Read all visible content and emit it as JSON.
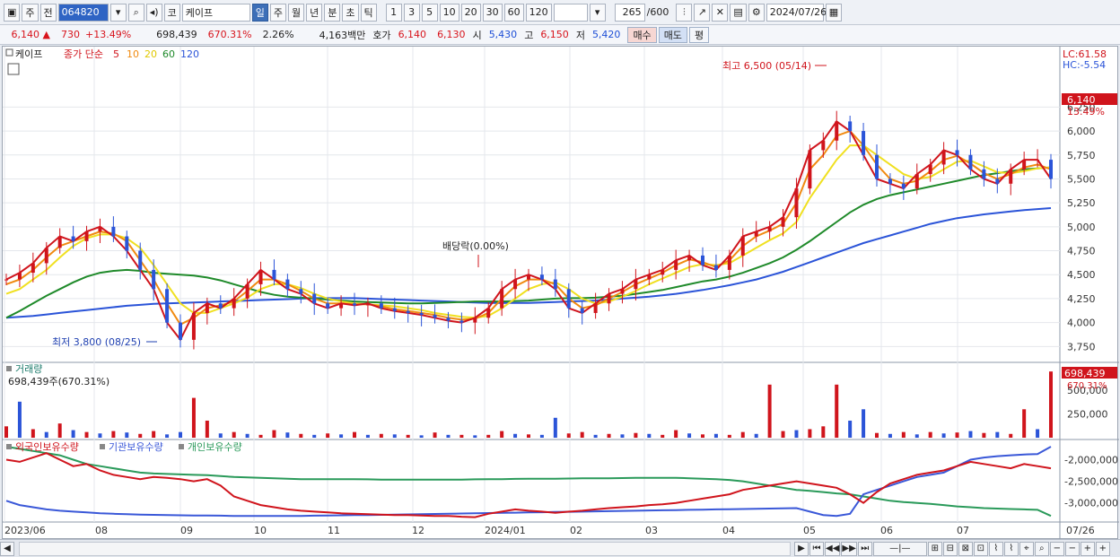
{
  "toolbar": {
    "market": "주",
    "prev": "전",
    "code": "064820",
    "type": "코",
    "name": "케이프",
    "periods": [
      "일",
      "주",
      "월",
      "년",
      "분",
      "초",
      "틱"
    ],
    "active_period": "일",
    "intervals": [
      "1",
      "3",
      "5",
      "10",
      "20",
      "30",
      "60",
      "120"
    ],
    "count": "265",
    "count_total": "/600",
    "date": "2024/07/26"
  },
  "quote": {
    "price": "6,140",
    "change": "730",
    "change_pct": "+13.49%",
    "volume": "698,439",
    "vol_ratio": "670.31%",
    "turnover": "2.26%",
    "amount": "4,163백만",
    "ask_label": "호가",
    "ask": "6,140",
    "bid": "6,130",
    "open_label": "시",
    "open": "5,430",
    "high_label": "고",
    "high": "6,150",
    "low_label": "저",
    "low": "5,420",
    "buy": "매수",
    "sell": "매도",
    "eval": "평"
  },
  "chart_data": {
    "type": "line",
    "legend": {
      "stock": "케이프",
      "ma_label": "종가 단순",
      "ma_periods": [
        "5",
        "10",
        "20",
        "60",
        "120"
      ],
      "ma_colors": [
        "#d0141c",
        "#f08a10",
        "#f0e020",
        "#1f8a2a",
        "#2b54d8"
      ]
    },
    "x_ticks": [
      "2023/06",
      "08",
      "09",
      "10",
      "11",
      "12",
      "2024/01",
      "02",
      "03",
      "04",
      "05",
      "06",
      "07",
      "07/26"
    ],
    "price_axis": {
      "ticks": [
        "6,250",
        "6,000",
        "5,750",
        "5,500",
        "5,250",
        "5,000",
        "4,750",
        "4,500",
        "4,250",
        "4,000",
        "3,750"
      ],
      "lc": "LC:61.58",
      "hc": "HC:-5.54",
      "current": "6,140",
      "current_pct": "13.49%",
      "ylim": [
        3650,
        6600
      ]
    },
    "annotations": {
      "high": "최고 6,500 (05/14)",
      "low": "최저 3,800 (08/25)",
      "dividend": "배당락(0.00%)"
    },
    "ma5": [
      4450,
      4520,
      4620,
      4780,
      4900,
      4850,
      4950,
      5000,
      4900,
      4750,
      4550,
      4350,
      4000,
      3820,
      4100,
      4200,
      4150,
      4250,
      4400,
      4550,
      4450,
      4350,
      4300,
      4200,
      4150,
      4200,
      4180,
      4200,
      4150,
      4120,
      4100,
      4080,
      4050,
      4020,
      4000,
      4050,
      4150,
      4350,
      4450,
      4500,
      4450,
      4350,
      4150,
      4100,
      4200,
      4300,
      4350,
      4450,
      4500,
      4550,
      4650,
      4700,
      4600,
      4550,
      4700,
      4900,
      4950,
      5000,
      5100,
      5400,
      5800,
      5900,
      6100,
      6000,
      5750,
      5500,
      5450,
      5400,
      5550,
      5650,
      5800,
      5750,
      5600,
      5500,
      5450,
      5600,
      5700,
      5700,
      5500
    ],
    "ma10": [
      4400,
      4450,
      4550,
      4680,
      4800,
      4850,
      4900,
      4950,
      4930,
      4850,
      4650,
      4450,
      4200,
      3980,
      4050,
      4150,
      4180,
      4220,
      4330,
      4450,
      4450,
      4400,
      4330,
      4250,
      4200,
      4200,
      4190,
      4190,
      4170,
      4140,
      4120,
      4100,
      4080,
      4050,
      4030,
      4040,
      4100,
      4250,
      4380,
      4450,
      4450,
      4400,
      4250,
      4150,
      4180,
      4250,
      4320,
      4400,
      4460,
      4520,
      4600,
      4660,
      4630,
      4580,
      4650,
      4800,
      4900,
      4960,
      5030,
      5250,
      5600,
      5750,
      5950,
      6000,
      5850,
      5650,
      5500,
      5450,
      5480,
      5580,
      5700,
      5740,
      5660,
      5560,
      5500,
      5550,
      5620,
      5650,
      5600
    ],
    "ma20": [
      4300,
      4350,
      4450,
      4550,
      4680,
      4800,
      4880,
      4920,
      4920,
      4880,
      4780,
      4600,
      4400,
      4200,
      4100,
      4100,
      4150,
      4200,
      4260,
      4350,
      4400,
      4400,
      4360,
      4300,
      4250,
      4220,
      4200,
      4190,
      4180,
      4170,
      4150,
      4130,
      4100,
      4080,
      4060,
      4050,
      4070,
      4150,
      4250,
      4350,
      4400,
      4420,
      4350,
      4250,
      4200,
      4220,
      4270,
      4330,
      4400,
      4460,
      4520,
      4580,
      4610,
      4600,
      4620,
      4700,
      4780,
      4860,
      4930,
      5050,
      5300,
      5500,
      5700,
      5850,
      5850,
      5750,
      5650,
      5550,
      5500,
      5520,
      5600,
      5680,
      5690,
      5630,
      5570,
      5560,
      5580,
      5610,
      5620
    ],
    "ma60": [
      4050,
      4120,
      4200,
      4280,
      4350,
      4420,
      4480,
      4520,
      4540,
      4550,
      4540,
      4520,
      4510,
      4500,
      4490,
      4470,
      4440,
      4400,
      4360,
      4320,
      4290,
      4270,
      4260,
      4250,
      4240,
      4230,
      4220,
      4215,
      4210,
      4205,
      4200,
      4200,
      4205,
      4210,
      4215,
      4220,
      4220,
      4220,
      4225,
      4230,
      4240,
      4250,
      4255,
      4255,
      4260,
      4270,
      4280,
      4300,
      4320,
      4340,
      4370,
      4400,
      4430,
      4450,
      4480,
      4520,
      4570,
      4620,
      4680,
      4760,
      4850,
      4950,
      5050,
      5150,
      5230,
      5290,
      5330,
      5360,
      5390,
      5420,
      5450,
      5480,
      5510,
      5540,
      5560,
      5580,
      5600,
      5610,
      5620
    ],
    "ma120": [
      4050,
      4060,
      4070,
      4085,
      4100,
      4115,
      4130,
      4145,
      4160,
      4175,
      4185,
      4195,
      4200,
      4205,
      4210,
      4215,
      4220,
      4225,
      4230,
      4235,
      4240,
      4245,
      4250,
      4255,
      4255,
      4255,
      4255,
      4250,
      4245,
      4240,
      4235,
      4230,
      4225,
      4220,
      4215,
      4210,
      4205,
      4205,
      4205,
      4205,
      4210,
      4215,
      4220,
      4225,
      4230,
      4240,
      4250,
      4260,
      4270,
      4285,
      4300,
      4320,
      4340,
      4365,
      4390,
      4420,
      4450,
      4490,
      4530,
      4580,
      4630,
      4680,
      4730,
      4780,
      4830,
      4870,
      4910,
      4950,
      4990,
      5030,
      5060,
      5090,
      5110,
      5130,
      5145,
      5160,
      5175,
      5185,
      5195
    ],
    "volume": {
      "label": "거래량",
      "value_text": "698,439주(670.31%)",
      "current": "698,439",
      "current_pct": "670.31%",
      "ticks": [
        "500,000",
        "250,000"
      ],
      "ylim": [
        0,
        700000
      ],
      "values": [
        120000,
        380000,
        90000,
        60000,
        150000,
        80000,
        60000,
        45000,
        70000,
        55000,
        40000,
        70000,
        35000,
        60000,
        420000,
        180000,
        45000,
        60000,
        40000,
        30000,
        80000,
        55000,
        40000,
        30000,
        45000,
        35000,
        60000,
        30000,
        40000,
        35000,
        30000,
        25000,
        55000,
        30000,
        30000,
        25000,
        30000,
        70000,
        40000,
        35000,
        30000,
        210000,
        45000,
        60000,
        30000,
        40000,
        35000,
        50000,
        40000,
        30000,
        80000,
        45000,
        35000,
        40000,
        30000,
        60000,
        40000,
        560000,
        70000,
        80000,
        90000,
        120000,
        560000,
        180000,
        300000,
        50000,
        40000,
        60000,
        35000,
        60000,
        45000,
        55000,
        70000,
        50000,
        60000,
        40000,
        300000,
        90000,
        698439
      ],
      "colors": [
        "r",
        "b",
        "r",
        "b",
        "r",
        "b",
        "r",
        "b",
        "r",
        "b",
        "r",
        "r",
        "b",
        "b",
        "r",
        "r",
        "b",
        "r",
        "b",
        "r",
        "r",
        "b",
        "r",
        "b",
        "r",
        "b",
        "r",
        "b",
        "r",
        "b",
        "r",
        "b",
        "r",
        "b",
        "r",
        "b",
        "r",
        "r",
        "b",
        "r",
        "b",
        "b",
        "r",
        "r",
        "b",
        "r",
        "b",
        "r",
        "b",
        "r",
        "r",
        "b",
        "r",
        "b",
        "r",
        "r",
        "b",
        "r",
        "r",
        "b",
        "r",
        "r",
        "r",
        "b",
        "b",
        "r",
        "b",
        "r",
        "b",
        "r",
        "b",
        "r",
        "b",
        "r",
        "b",
        "r",
        "r",
        "b",
        "r"
      ]
    },
    "holdings": {
      "labels": [
        "외국인보유수량",
        "기관보유수량",
        "개인보유수량"
      ],
      "colors": [
        "#d0141c",
        "#3a58d8",
        "#2a9a5a"
      ],
      "ticks": [
        "-2,000,000",
        "-2,500,000",
        "-3,000,000"
      ],
      "ylim": [
        -3400000,
        -1700000
      ],
      "foreign": [
        -2000000,
        -2050000,
        -1950000,
        -1850000,
        -2000000,
        -2150000,
        -2100000,
        -2250000,
        -2350000,
        -2400000,
        -2450000,
        -2400000,
        -2420000,
        -2450000,
        -2500000,
        -2450000,
        -2600000,
        -2850000,
        -2950000,
        -3050000,
        -3100000,
        -3150000,
        -3180000,
        -3200000,
        -3220000,
        -3240000,
        -3250000,
        -3260000,
        -3270000,
        -3280000,
        -3280000,
        -3290000,
        -3300000,
        -3300000,
        -3320000,
        -3330000,
        -3250000,
        -3200000,
        -3150000,
        -3180000,
        -3200000,
        -3230000,
        -3200000,
        -3180000,
        -3150000,
        -3120000,
        -3100000,
        -3080000,
        -3050000,
        -3030000,
        -3000000,
        -2950000,
        -2900000,
        -2850000,
        -2800000,
        -2700000,
        -2650000,
        -2600000,
        -2550000,
        -2500000,
        -2550000,
        -2600000,
        -2650000,
        -2800000,
        -3000000,
        -2750000,
        -2550000,
        -2450000,
        -2350000,
        -2300000,
        -2250000,
        -2150000,
        -2050000,
        -2100000,
        -2150000,
        -2200000,
        -2100000,
        -2150000,
        -2200000
      ],
      "institution": [
        -2950000,
        -3050000,
        -3100000,
        -3150000,
        -3180000,
        -3200000,
        -3220000,
        -3240000,
        -3250000,
        -3260000,
        -3270000,
        -3275000,
        -3280000,
        -3285000,
        -3290000,
        -3290000,
        -3295000,
        -3300000,
        -3300000,
        -3300000,
        -3300000,
        -3300000,
        -3300000,
        -3295000,
        -3290000,
        -3285000,
        -3280000,
        -3280000,
        -3275000,
        -3270000,
        -3265000,
        -3260000,
        -3255000,
        -3250000,
        -3245000,
        -3240000,
        -3235000,
        -3230000,
        -3225000,
        -3220000,
        -3215000,
        -3210000,
        -3205000,
        -3200000,
        -3195000,
        -3190000,
        -3185000,
        -3180000,
        -3175000,
        -3170000,
        -3165000,
        -3160000,
        -3155000,
        -3150000,
        -3145000,
        -3140000,
        -3135000,
        -3130000,
        -3125000,
        -3120000,
        -3200000,
        -3280000,
        -3300000,
        -3250000,
        -2800000,
        -2700000,
        -2600000,
        -2500000,
        -2400000,
        -2350000,
        -2300000,
        -2150000,
        -2000000,
        -1950000,
        -1920000,
        -1900000,
        -1880000,
        -1870000,
        -1700000
      ],
      "individual": [
        -1700000,
        -1750000,
        -1800000,
        -1850000,
        -1900000,
        -2000000,
        -2100000,
        -2150000,
        -2200000,
        -2250000,
        -2300000,
        -2320000,
        -2330000,
        -2340000,
        -2350000,
        -2360000,
        -2380000,
        -2400000,
        -2410000,
        -2420000,
        -2430000,
        -2440000,
        -2450000,
        -2450000,
        -2450000,
        -2450000,
        -2450000,
        -2455000,
        -2460000,
        -2460000,
        -2460000,
        -2460000,
        -2460000,
        -2460000,
        -2460000,
        -2455000,
        -2450000,
        -2450000,
        -2445000,
        -2440000,
        -2440000,
        -2440000,
        -2435000,
        -2430000,
        -2430000,
        -2430000,
        -2425000,
        -2420000,
        -2420000,
        -2420000,
        -2420000,
        -2430000,
        -2440000,
        -2450000,
        -2470000,
        -2500000,
        -2550000,
        -2600000,
        -2650000,
        -2700000,
        -2720000,
        -2750000,
        -2780000,
        -2800000,
        -2850000,
        -2900000,
        -2950000,
        -2980000,
        -3000000,
        -3020000,
        -3050000,
        -3080000,
        -3100000,
        -3120000,
        -3130000,
        -3140000,
        -3150000,
        -3160000,
        -3300000
      ]
    }
  },
  "statusbar": {
    "buttons": [
      "◀",
      "▶",
      "⏮",
      "◀◀",
      "▶▶",
      "⏭"
    ]
  }
}
